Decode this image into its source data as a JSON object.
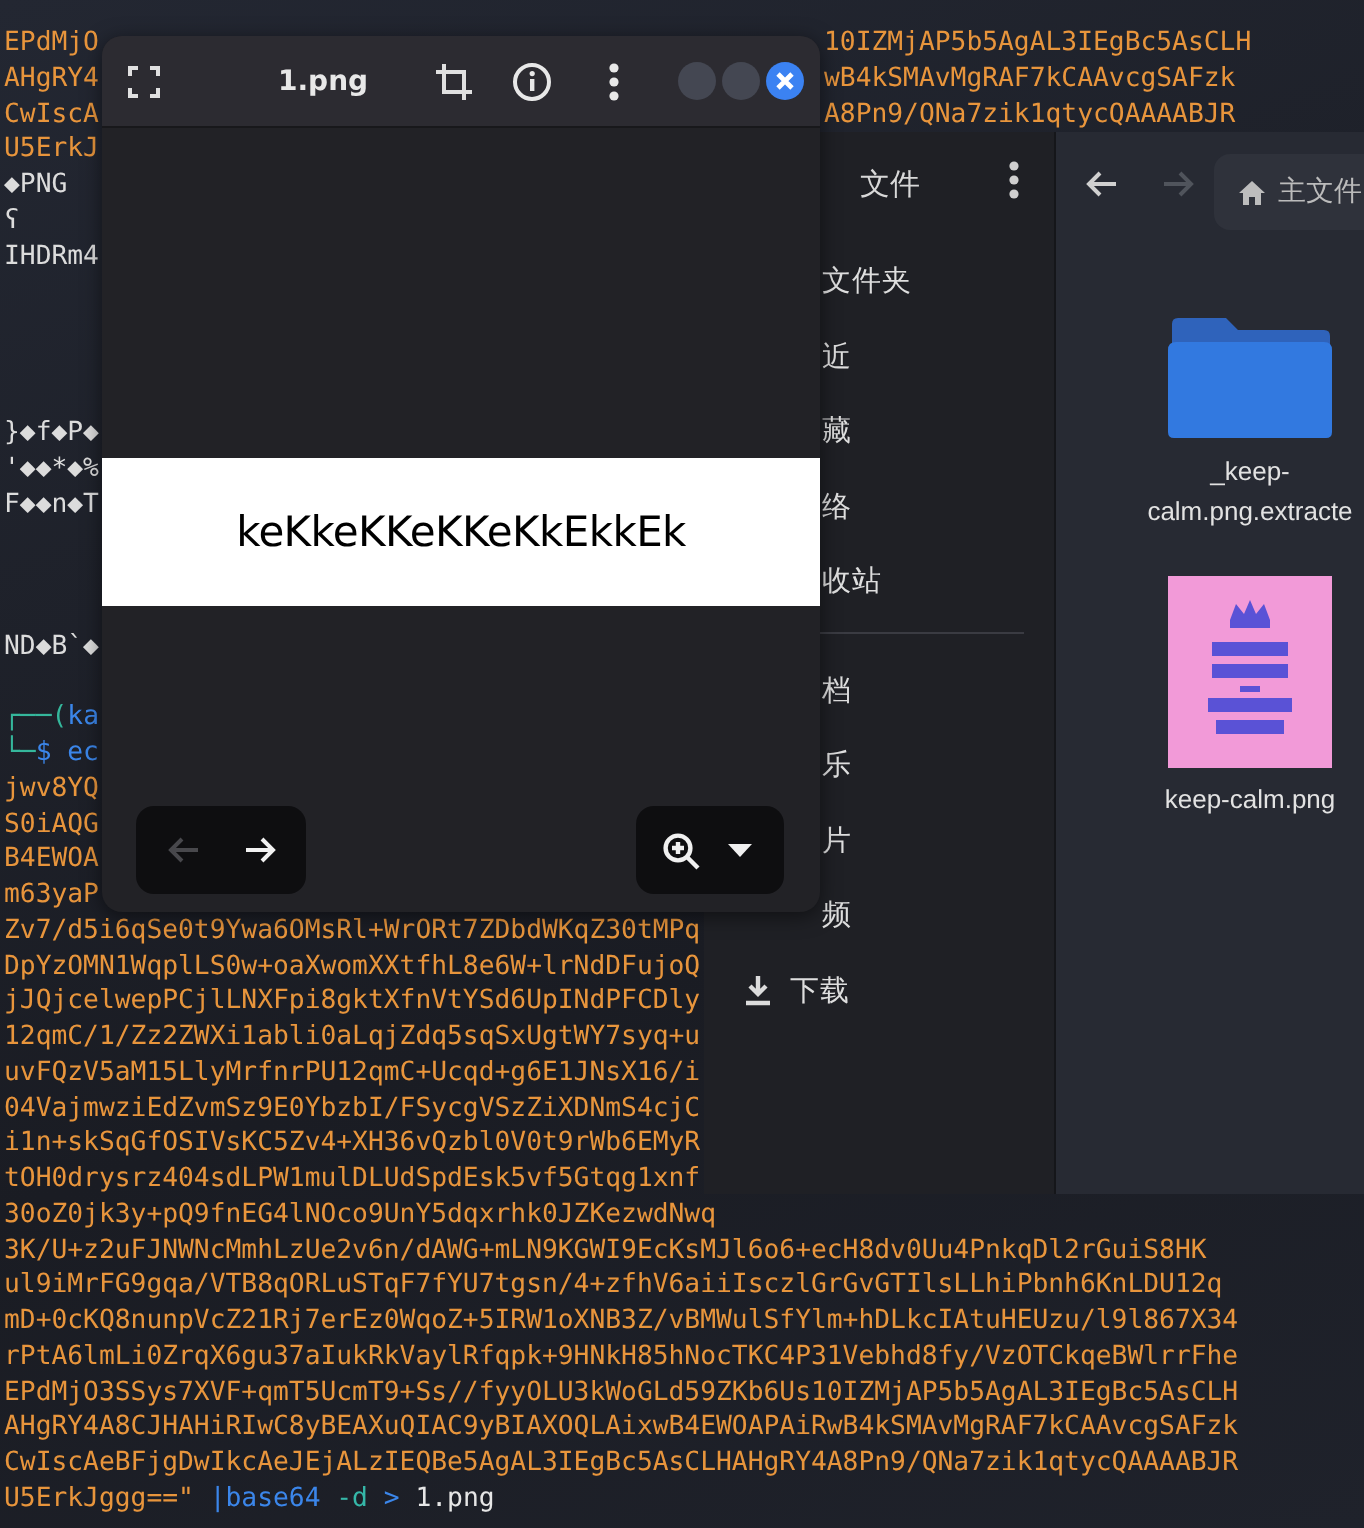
{
  "terminal": {
    "lines": [
      {
        "kind": "split",
        "left": "EPdMjO",
        "right": "10IZMjAP5b5AgAL3IEgBc5AsCLH",
        "color": "#e8953c"
      },
      {
        "kind": "split",
        "left": "AHgRY4",
        "right": "wB4kSMAvMgRAF7kCAAvcgSAFzk",
        "color": "#e8953c"
      },
      {
        "kind": "split",
        "left": "CwIscA",
        "right": "A8Pn9/QNa7zik1qtycQAAAABJR",
        "color": "#e8953c"
      },
      {
        "kind": "plain",
        "text": "U5ErkJ",
        "color": "#e8953c"
      },
      {
        "kind": "plain",
        "text": "◆PNG",
        "color": "#dcdcdc"
      },
      {
        "kind": "plain",
        "text": "ʕ",
        "color": "#dcdcdc"
      },
      {
        "kind": "plain",
        "text": "IHDRm4",
        "color": "#dcdcdc"
      },
      {
        "kind": "plain",
        "text": "}◆f◆P◆",
        "color": "#dcdcdc"
      },
      {
        "kind": "plain",
        "text": "'◆◆*◆%",
        "color": "#dcdcdc"
      },
      {
        "kind": "plain",
        "text": "F◆◆n◆T",
        "color": "#dcdcdc"
      },
      {
        "kind": "plain",
        "text": "ND◆B`◆",
        "color": "#dcdcdc"
      },
      {
        "kind": "segments",
        "segments": [
          {
            "text": "┌──(",
            "color": "#35b79c"
          },
          {
            "text": "ka",
            "color": "#3b86ea"
          }
        ]
      },
      {
        "kind": "segments",
        "segments": [
          {
            "text": "└─",
            "color": "#35b79c"
          },
          {
            "text": "$ ec",
            "color": "#3b86ea"
          }
        ]
      },
      {
        "kind": "plain",
        "text": "jwv8YQ",
        "color": "#e8953c"
      },
      {
        "kind": "plain",
        "text": "S0iAQG",
        "color": "#e8953c"
      },
      {
        "kind": "plain",
        "text": "B4EWOA",
        "color": "#e8953c"
      },
      {
        "kind": "plain",
        "text": "m63yaP",
        "color": "#e8953c"
      },
      {
        "kind": "plain",
        "text": "Zv7/d5i6qSe0t9Ywa6OMsRl+WrORt7ZDbdWKqZ30tMPq",
        "color": "#e8953c"
      },
      {
        "kind": "plain",
        "text": "DpYzOMN1WqplLS0w+oaXwomXXtfhL8e6W+lrNdDFujoQ",
        "color": "#e8953c"
      },
      {
        "kind": "plain",
        "text": "jJQjcelwepPCjlLNXFpi8gktXfnVtYSd6UpINdPFCDly",
        "color": "#e8953c"
      },
      {
        "kind": "plain",
        "text": "12qmC/1/Zz2ZWXi1abli0aLqjZdq5sqSxUgtWY7syq+u",
        "color": "#e8953c"
      },
      {
        "kind": "plain",
        "text": "uvFQzV5aM15LlyMrfnrPU12qmC+Ucqd+g6E1JNsX16/i",
        "color": "#e8953c"
      },
      {
        "kind": "plain",
        "text": "04VajmwziEdZvmSz9E0YbzbI/FSycgVSzZiXDNmS4cjC",
        "color": "#e8953c"
      },
      {
        "kind": "plain",
        "text": "i1n+skSqGfOSIVsKC5Zv4+XH36vQzbl0V0t9rWb6EMyR",
        "color": "#e8953c"
      },
      {
        "kind": "plain",
        "text": "tOH0drysrz404sdLPW1mulDLUdSpdEsk5vf5Gtqg1xnf",
        "color": "#e8953c"
      },
      {
        "kind": "plain",
        "text": "30oZ0jk3y+pQ9fnEG4lNOco9UnY5dqxrhk0JZKezwdNwq",
        "color": "#e8953c"
      },
      {
        "kind": "plain",
        "text": "3K/U+z2uFJNWNcMmhLzUe2v6n/dAWG+mLN9KGWI9EcKsMJl6o6+ecH8dv0Uu4PnkqDl2rGuiS8HK",
        "color": "#e8953c"
      },
      {
        "kind": "plain",
        "text": "ul9iMrFG9gqa/VTB8qORLuSTqF7fYU7tgsn/4+zfhV6aiiIsczlGrGvGTIlsLLhiPbnh6KnLDU12q",
        "color": "#e8953c"
      },
      {
        "kind": "plain",
        "text": "mD+0cKQ8nunpVcZ21Rj7erEz0WqoZ+5IRW1oXNB3Z/vBMWulSfYlm+hDLkcIAtuHEUzu/l9l867X34",
        "color": "#e8953c"
      },
      {
        "kind": "plain",
        "text": "rPtA6lmLi0ZrqX6gu37aIukRkVaylRfqpk+9HNkH85hNocTKC4P31Vebhd8fy/VzOTCkqeBWlrrFhe",
        "color": "#e8953c"
      },
      {
        "kind": "plain",
        "text": "EPdMjO3SSys7XVF+qmT5UcmT9+Ss//fyyOLU3kWoGLd59ZKb6Us10IZMjAP5b5AgAL3IEgBc5AsCLH",
        "color": "#e8953c"
      },
      {
        "kind": "plain",
        "text": "AHgRY4A8CJHAHiRIwC8yBEAXuQIAC9yBIAXOQLAixwB4EWOAPAiRwB4kSMAvMgRAF7kCAAvcgSAFzk",
        "color": "#e8953c"
      },
      {
        "kind": "plain",
        "text": "CwIscAeBFjgDwIkcAeJEjALzIEQBe5AgAL3IEgBc5AsCLHAHgRY4A8Pn9/QNa7zik1qtycQAAAABJR",
        "color": "#e8953c"
      },
      {
        "kind": "segments",
        "segments": [
          {
            "text": "U5ErkJggg==\"",
            "color": "#e8953c"
          },
          {
            "text": " |base64",
            "color": "#3b86ea"
          },
          {
            "text": " -d",
            "color": "#35b7a8"
          },
          {
            "text": " >",
            "color": "#3b86ea"
          },
          {
            "text": " 1.png",
            "color": "#e6e6e6"
          }
        ]
      }
    ]
  },
  "files": {
    "sidebar_title": "文件",
    "places": [
      {
        "kind": "partial",
        "label": "文件夹"
      },
      {
        "kind": "partial",
        "label": "近"
      },
      {
        "kind": "partial",
        "label": "藏"
      },
      {
        "kind": "partial",
        "label": "络"
      },
      {
        "kind": "partial",
        "label": "收站"
      }
    ],
    "bookmarks": [
      {
        "kind": "partial",
        "label": "档"
      },
      {
        "kind": "partial",
        "label": "乐"
      },
      {
        "kind": "partial",
        "label": "片"
      },
      {
        "kind": "partial",
        "label": "频"
      },
      {
        "kind": "full",
        "label": "下载"
      }
    ],
    "back_button": {
      "disabled": false
    },
    "forward_button": {
      "disabled": true
    },
    "path": "主文件",
    "items": [
      {
        "kind": "folder",
        "name": "_keep-calm.png.extracte"
      },
      {
        "kind": "picture",
        "name": "keep-calm.png"
      }
    ]
  },
  "viewer": {
    "title": "1.png",
    "image_text": "keKkeKKeKKeKkEkkEk",
    "prev_button": {
      "disabled": true
    },
    "next_button": {
      "disabled": false
    }
  }
}
